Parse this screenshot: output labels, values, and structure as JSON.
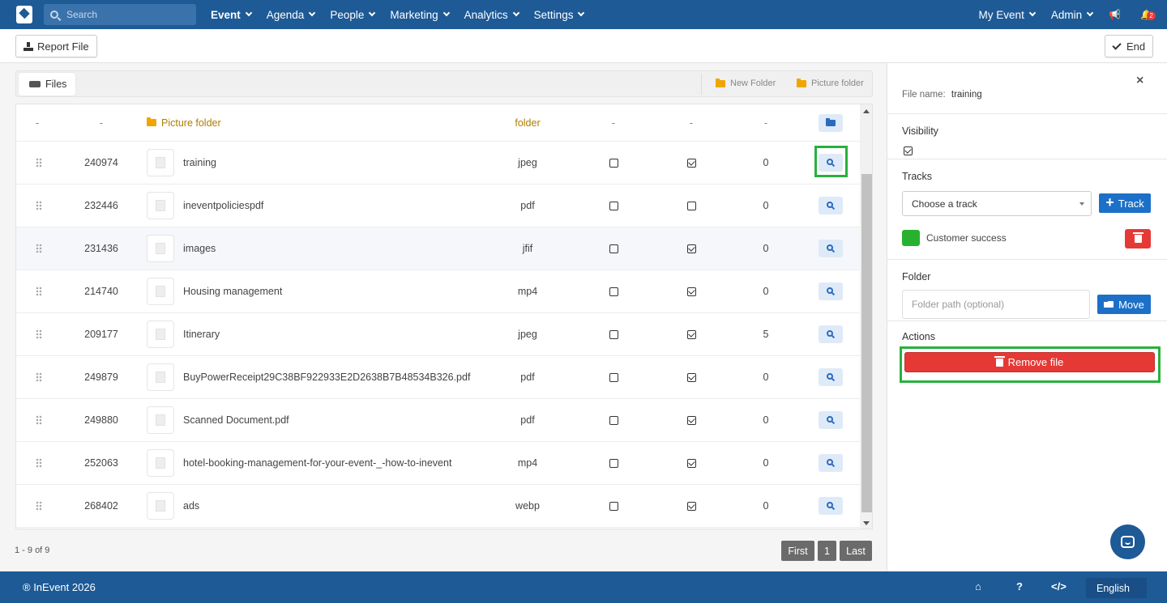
{
  "nav": {
    "search_placeholder": "Search",
    "menu": [
      "Event",
      "Agenda",
      "People",
      "Marketing",
      "Analytics",
      "Settings"
    ],
    "my_event": "My Event",
    "admin": "Admin",
    "notification_count": "2"
  },
  "toolbar": {
    "report_label": "Report File",
    "end_label": "End"
  },
  "files": {
    "tab_label": "Files",
    "new_folder": "New Folder",
    "picture_folder_link": "Picture folder",
    "folder_row": {
      "id": "-",
      "drag": "-",
      "name": "Picture folder",
      "ext": "folder",
      "vis": "-",
      "dl": "-",
      "cnt": "-"
    },
    "rows": [
      {
        "id": "240974",
        "name": "training",
        "ext": "jpeg",
        "visible": false,
        "downloadable": true,
        "count": "0"
      },
      {
        "id": "232446",
        "name": "ineventpoliciespdf",
        "ext": "pdf",
        "visible": false,
        "downloadable": false,
        "count": "0"
      },
      {
        "id": "231436",
        "name": "images",
        "ext": "jfif",
        "visible": false,
        "downloadable": true,
        "count": "0"
      },
      {
        "id": "214740",
        "name": "Housing management",
        "ext": "mp4",
        "visible": false,
        "downloadable": true,
        "count": "0"
      },
      {
        "id": "209177",
        "name": "Itinerary",
        "ext": "jpeg",
        "visible": false,
        "downloadable": true,
        "count": "5"
      },
      {
        "id": "249879",
        "name": "BuyPowerReceipt29C38BF922933E2D2638B7B48534B326.pdf",
        "ext": "pdf",
        "visible": false,
        "downloadable": true,
        "count": "0"
      },
      {
        "id": "249880",
        "name": "Scanned Document.pdf",
        "ext": "pdf",
        "visible": false,
        "downloadable": true,
        "count": "0"
      },
      {
        "id": "252063",
        "name": "hotel-booking-management-for-your-event-_-how-to-inevent",
        "ext": "mp4",
        "visible": false,
        "downloadable": true,
        "count": "0"
      },
      {
        "id": "268402",
        "name": "ads",
        "ext": "webp",
        "visible": false,
        "downloadable": true,
        "count": "0"
      }
    ],
    "pager_info": "1 - 9 of 9",
    "pager": {
      "first": "First",
      "page": "1",
      "last": "Last"
    }
  },
  "panel": {
    "close": "×",
    "file_name_label": "File name:",
    "file_name": "training",
    "visibility_label": "Visibility",
    "visibility_checked": true,
    "tracks_label": "Tracks",
    "track_select": "Choose a track",
    "track_button": "Track",
    "track_name": "Customer success",
    "track_color": "#27b12f",
    "folder_label": "Folder",
    "folder_placeholder": "Folder path (optional)",
    "move_button": "Move",
    "actions_label": "Actions",
    "remove_button": "Remove file"
  },
  "footer": {
    "copyright": "® InEvent 2026",
    "language": "English"
  }
}
